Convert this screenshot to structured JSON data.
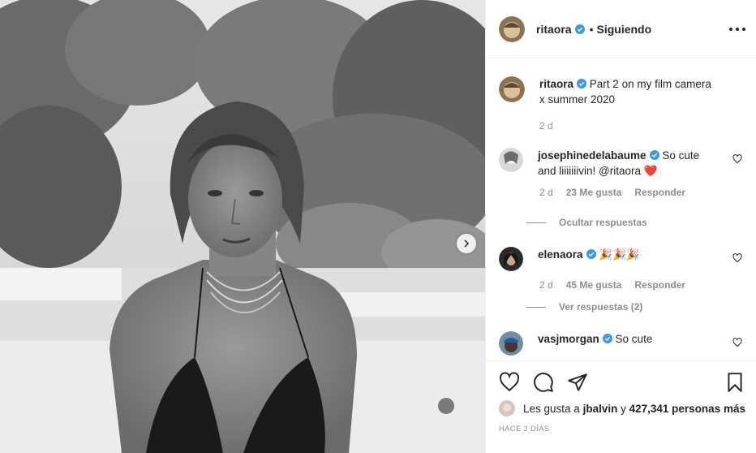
{
  "post": {
    "author": "ritaora",
    "follow_state": "Siguiendo",
    "dot": "•",
    "caption": "Part 2 on my film camera x summer 2020",
    "caption_age": "2 d"
  },
  "comments": [
    {
      "username": "josephinedelabaume",
      "text": "So cute and liiiiiiivin! @ritaora ❤️",
      "age": "2 d",
      "likes": "23 Me gusta",
      "reply": "Responder",
      "replies_toggle": "Ocultar respuestas"
    },
    {
      "username": "elenaora",
      "text": "🎉🎉🎉",
      "age": "2 d",
      "likes": "45 Me gusta",
      "reply": "Responder",
      "replies_toggle": "Ver respuestas (2)"
    },
    {
      "username": "vasjmorgan",
      "text": "So cute"
    }
  ],
  "likes": {
    "prefix": "Les gusta a",
    "first_user": "jbalvin",
    "conj": "y",
    "count_text": "427,341 personas más"
  },
  "timestamp": "HACE 2 DÍAS",
  "colors": {
    "verified": "#3897f0",
    "muted": "#8e8e8e",
    "text": "#262626",
    "divider": "#efefef"
  },
  "icons": {
    "like": "heart-icon",
    "comment": "comment-icon",
    "share": "paper-plane-icon",
    "save": "bookmark-icon",
    "more": "ellipsis-icon",
    "next": "chevron-right-icon"
  }
}
